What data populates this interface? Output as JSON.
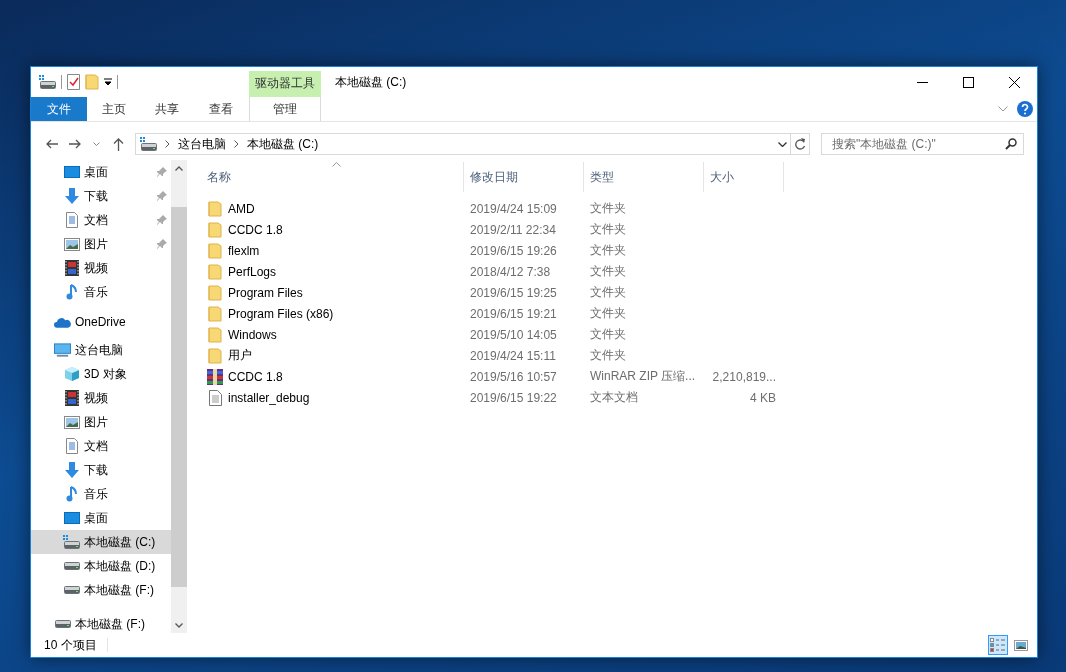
{
  "window": {
    "title": "本地磁盘 (C:)",
    "context_tab_group": "驱动器工具"
  },
  "ribbon": {
    "tabs": [
      {
        "label": "文件",
        "kind": "file"
      },
      {
        "label": "主页",
        "kind": "normal"
      },
      {
        "label": "共享",
        "kind": "normal"
      },
      {
        "label": "查看",
        "kind": "normal"
      },
      {
        "label": "管理",
        "kind": "context"
      }
    ]
  },
  "address": {
    "path": [
      "这台电脑",
      "本地磁盘 (C:)"
    ],
    "search": {
      "placeholder": "搜索\"本地磁盘 (C:)\""
    }
  },
  "sidebar": {
    "quick_access": [
      {
        "label": "桌面",
        "kind": "desktop",
        "pinned": true,
        "selected": false
      },
      {
        "label": "下载",
        "kind": "download",
        "pinned": true,
        "selected": false
      },
      {
        "label": "文档",
        "kind": "document",
        "pinned": true,
        "selected": false
      },
      {
        "label": "图片",
        "kind": "picture",
        "pinned": true,
        "selected": false
      },
      {
        "label": "视频",
        "kind": "video",
        "pinned": false,
        "selected": false
      },
      {
        "label": "音乐",
        "kind": "music",
        "pinned": false,
        "selected": false
      }
    ],
    "tree": [
      {
        "label": "OneDrive",
        "kind": "cloud",
        "selected": false
      },
      {
        "label": "这台电脑",
        "kind": "pc",
        "selected": false,
        "children": [
          {
            "label": "3D 对象",
            "kind": "cube",
            "selected": false
          },
          {
            "label": "视频",
            "kind": "video",
            "selected": false
          },
          {
            "label": "图片",
            "kind": "picture",
            "selected": false
          },
          {
            "label": "文档",
            "kind": "document",
            "selected": false
          },
          {
            "label": "下载",
            "kind": "download",
            "selected": false
          },
          {
            "label": "音乐",
            "kind": "music",
            "selected": false
          },
          {
            "label": "桌面",
            "kind": "desktop",
            "selected": false
          },
          {
            "label": "本地磁盘 (C:)",
            "kind": "system-drive",
            "selected": true
          },
          {
            "label": "本地磁盘 (D:)",
            "kind": "drive",
            "selected": false
          },
          {
            "label": "本地磁盘 (F:)",
            "kind": "drive",
            "selected": false
          }
        ]
      },
      {
        "label": "本地磁盘 (F:)",
        "kind": "drive",
        "selected": false
      }
    ]
  },
  "files": {
    "columns": [
      {
        "label": "名称",
        "sorted": true
      },
      {
        "label": "修改日期",
        "sorted": false
      },
      {
        "label": "类型",
        "sorted": false
      },
      {
        "label": "大小",
        "sorted": false
      }
    ],
    "rows": [
      {
        "name": "AMD",
        "modified": "2019/4/24 15:09",
        "type": "文件夹",
        "kind": "folder"
      },
      {
        "name": "CCDC 1.8",
        "modified": "2019/2/11 22:34",
        "type": "文件夹",
        "kind": "folder"
      },
      {
        "name": "flexlm",
        "modified": "2019/6/15 19:26",
        "type": "文件夹",
        "kind": "folder"
      },
      {
        "name": "PerfLogs",
        "modified": "2018/4/12 7:38",
        "type": "文件夹",
        "kind": "folder"
      },
      {
        "name": "Program Files",
        "modified": "2019/6/15 19:25",
        "type": "文件夹",
        "kind": "folder"
      },
      {
        "name": "Program Files (x86)",
        "modified": "2019/6/15 19:21",
        "type": "文件夹",
        "kind": "folder"
      },
      {
        "name": "Windows",
        "modified": "2019/5/10 14:05",
        "type": "文件夹",
        "kind": "folder"
      },
      {
        "name": "用户",
        "modified": "2019/4/24 15:11",
        "type": "文件夹",
        "kind": "folder"
      },
      {
        "name": "CCDC 1.8",
        "modified": "2019/5/16 10:57",
        "type": "WinRAR ZIP 压缩...",
        "size": "2,210,819...",
        "kind": "archive"
      },
      {
        "name": "installer_debug",
        "modified": "2019/6/15 19:22",
        "type": "文本文档",
        "size": "4 KB",
        "kind": "text"
      }
    ]
  },
  "status_bar": {
    "item_count": "10 个项目",
    "views": [
      {
        "kind": "details",
        "selected": true
      },
      {
        "kind": "thumbnails",
        "selected": false
      }
    ]
  }
}
